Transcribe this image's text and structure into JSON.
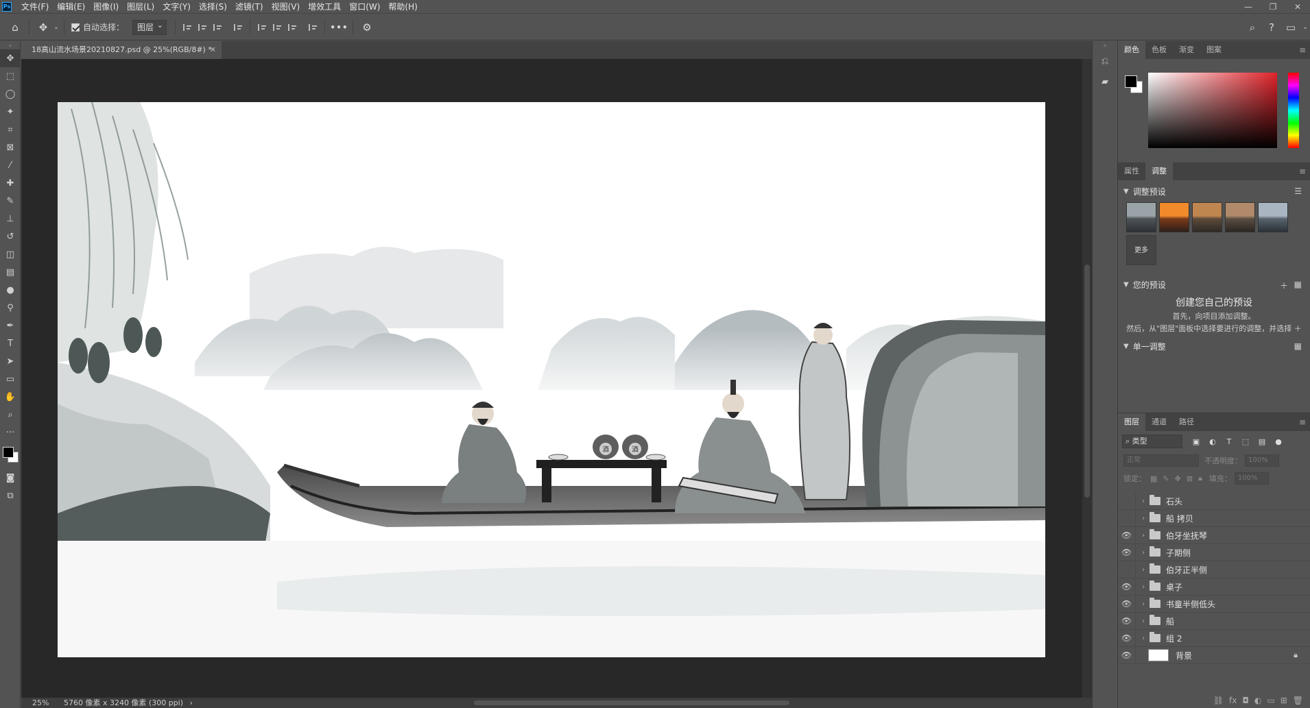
{
  "app": {
    "logo_text": "Ps"
  },
  "menu": [
    "文件(F)",
    "编辑(E)",
    "图像(I)",
    "图层(L)",
    "文字(Y)",
    "选择(S)",
    "滤镜(T)",
    "视图(V)",
    "增效工具",
    "窗口(W)",
    "帮助(H)"
  ],
  "options": {
    "auto_select_label": "自动选择：",
    "auto_select_target": "图层"
  },
  "document": {
    "tab_title": "18高山流水场景20210827.psd @ 25%(RGB/8#) *",
    "zoom": "25%",
    "info": "5760 像素 x 3240 像素 (300 ppi)"
  },
  "panels": {
    "color_tabs": [
      "颜色",
      "色板",
      "渐变",
      "图案"
    ],
    "adjust_tabs": [
      "属性",
      "调整"
    ],
    "adjust_presets_title": "调整预设",
    "more_label": "更多",
    "your_presets_title": "您的预设",
    "create_title": "创建您自己的预设",
    "create_line1": "首先，向项目添加调整。",
    "create_line2": "然后，从\"图层\"面板中选择要进行的调整，并选择 ＋",
    "single_adjust_title": "单一调整",
    "layers_tabs": [
      "图层",
      "通道",
      "路径"
    ],
    "kind_label": "类型",
    "blend_mode": "正常",
    "opacity_label": "不透明度：",
    "opacity_value": "100%",
    "lock_label": "锁定：",
    "fill_label": "填充：",
    "fill_value": "100%"
  },
  "layers": [
    {
      "name": "石头",
      "visible": false,
      "type": "group"
    },
    {
      "name": "船 拷贝",
      "visible": false,
      "type": "group"
    },
    {
      "name": "伯牙坐抚琴",
      "visible": true,
      "type": "group"
    },
    {
      "name": "子期侧",
      "visible": true,
      "type": "group"
    },
    {
      "name": "伯牙正半侧",
      "visible": false,
      "type": "group"
    },
    {
      "name": "桌子",
      "visible": true,
      "type": "group"
    },
    {
      "name": "书童半侧低头",
      "visible": true,
      "type": "group"
    },
    {
      "name": "船",
      "visible": true,
      "type": "group"
    },
    {
      "name": "组 2",
      "visible": true,
      "type": "group"
    },
    {
      "name": "背景",
      "visible": true,
      "type": "background"
    }
  ],
  "artwork": {
    "jar_label": "酒"
  },
  "colors": {
    "foreground": "#000000",
    "background": "#ffffff",
    "accent": "#e0232a"
  }
}
